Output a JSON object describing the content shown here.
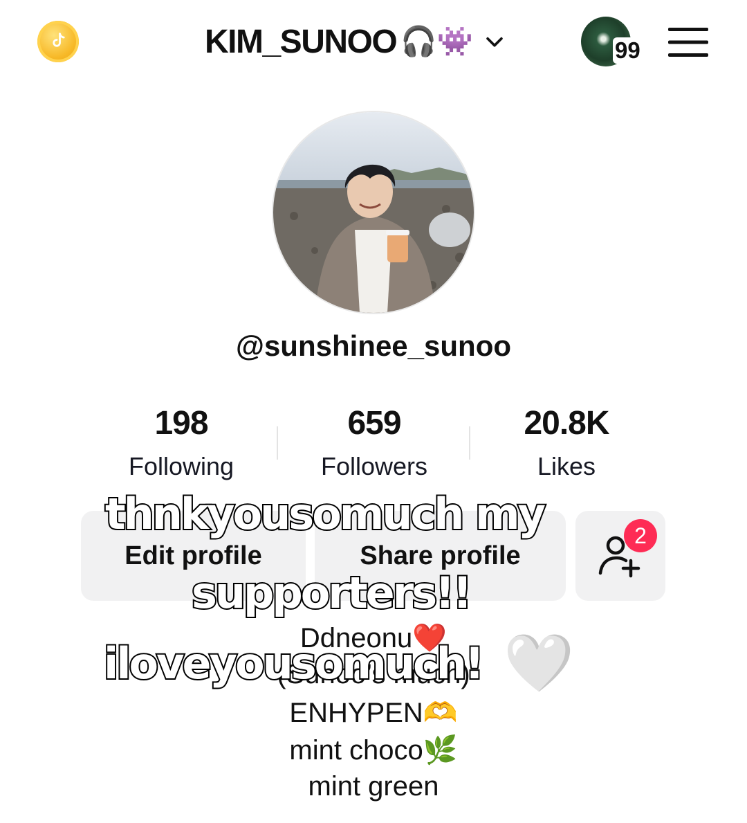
{
  "header": {
    "title": "KIM_SUNOO",
    "title_emojis": "🎧👾",
    "notification_count": "99",
    "coin_icon": "tiktok-coin-icon",
    "menu_icon": "hamburger-menu-icon"
  },
  "profile": {
    "handle": "@sunshinee_sunoo"
  },
  "stats": [
    {
      "value": "198",
      "label": "Following"
    },
    {
      "value": "659",
      "label": "Followers"
    },
    {
      "value": "20.8K",
      "label": "Likes"
    }
  ],
  "actions": {
    "edit_label": "Edit profile",
    "share_label": "Share profile",
    "add_friend_badge": "2"
  },
  "bio": [
    "Ddneonu❤️",
    "(Sunoo’s much)",
    "ENHYPEN🫶",
    "mint choco🌿",
    "mint green"
  ],
  "overlay_caption": {
    "line1": "thnkyousomuch my",
    "line2": "supporters!!",
    "line3": "iloveyousomuch!",
    "heart": "🤍"
  },
  "colors": {
    "accent_red": "#fe2c55",
    "button_bg": "#f1f1f2",
    "coin_gold": "#f7b928"
  }
}
